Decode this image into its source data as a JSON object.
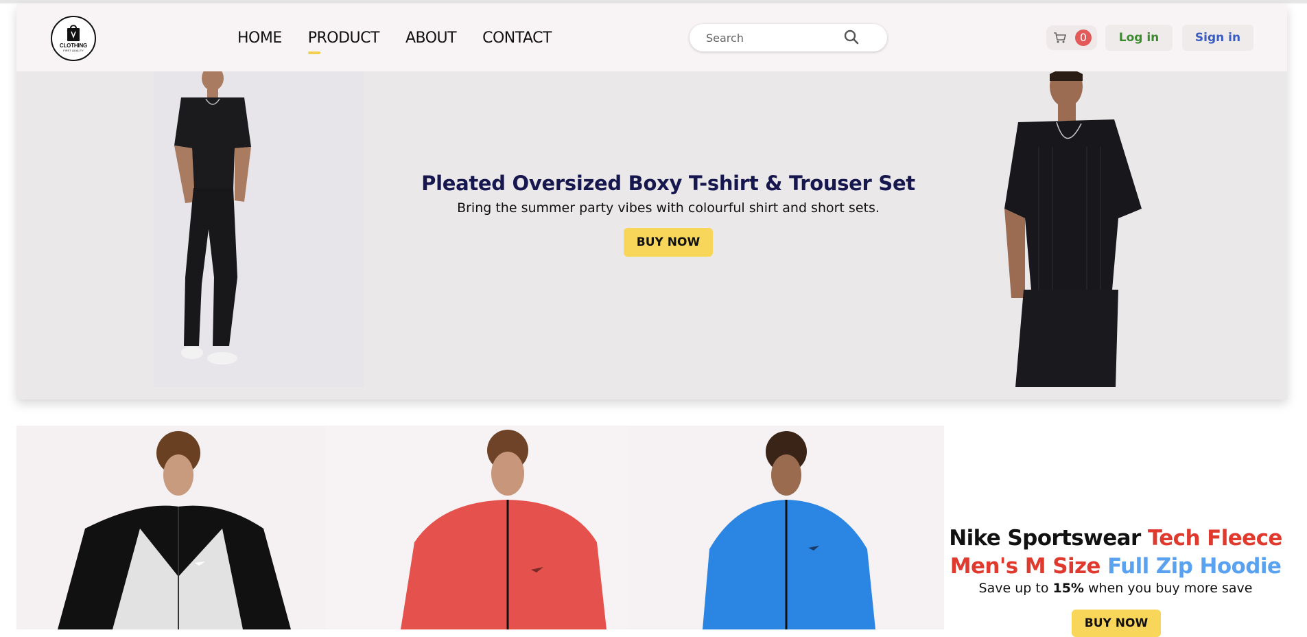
{
  "header": {
    "logo": {
      "text": "CLOTHING",
      "subtext": "FIRST QUALITY"
    },
    "nav": [
      {
        "label": "HOME"
      },
      {
        "label": "PRODUCT"
      },
      {
        "label": "ABOUT"
      },
      {
        "label": "CONTACT"
      }
    ],
    "active_nav": "PRODUCT",
    "search": {
      "placeholder": "Search",
      "value": ""
    },
    "cart": {
      "count": "0"
    },
    "login_label": "Log in",
    "signin_label": "Sign in"
  },
  "hero": {
    "title": "Pleated Oversized Boxy T-shirt & Trouser Set",
    "subtitle": "Bring the summer party vibes with colourful shirt and short sets.",
    "cta_label": "BUY NOW"
  },
  "products": [
    {
      "name": "hoodie-black-grey",
      "colors": {
        "body": "#e5e5e5",
        "top": "#111111"
      }
    },
    {
      "name": "hoodie-red",
      "colors": {
        "body": "#e8524e",
        "top": "#e8524e"
      }
    },
    {
      "name": "hoodie-blue",
      "colors": {
        "body": "#2b86e3",
        "top": "#2b86e3"
      }
    }
  ],
  "promo": {
    "title_part1": "Nike Sportswear ",
    "title_part2": "Tech Fleece Men's M Size ",
    "title_part3": "Full Zip Hoodie",
    "sub_before": "Save up to ",
    "sub_bold": "15%",
    "sub_after": " when you buy more save",
    "cta_label": "BUY NOW"
  },
  "colors": {
    "accent_yellow": "#f7d65a",
    "title_navy": "#17174f",
    "login_green": "#3b8a2f",
    "signin_blue": "#3a5cc2",
    "badge_red": "#e25a5a"
  }
}
